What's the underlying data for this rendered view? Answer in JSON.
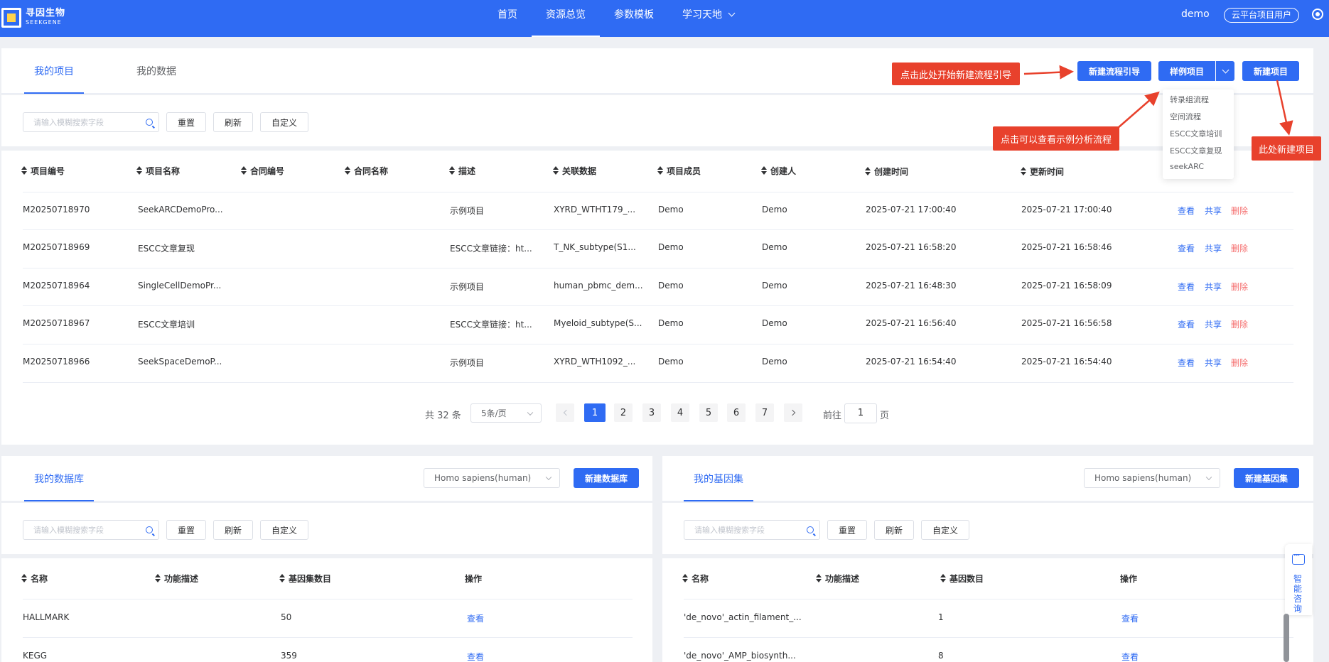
{
  "brand": {
    "name_cn": "寻因生物",
    "name_en": "SEEKGENE"
  },
  "nav": {
    "items": [
      {
        "label": "首页",
        "active": false
      },
      {
        "label": "资源总览",
        "active": true
      },
      {
        "label": "参数模板",
        "active": false
      },
      {
        "label": "学习天地",
        "active": false
      }
    ],
    "user": "demo",
    "role": "云平台项目用户"
  },
  "projects": {
    "tabs": [
      "我的项目",
      "我的数据"
    ],
    "buttons": {
      "new_flow": "新建流程引导",
      "sample": "样例项目",
      "new_project": "新建项目"
    },
    "sample_menu": [
      "转录组流程",
      "空间流程",
      "ESCC文章培训",
      "ESCC文章复现",
      "seekARC"
    ],
    "toolbar": {
      "search_placeholder": "请输入模糊搜索字段",
      "reset": "重置",
      "refresh": "刷新",
      "custom": "自定义"
    },
    "columns": [
      "项目编号",
      "项目名称",
      "合同编号",
      "合同名称",
      "描述",
      "关联数据",
      "项目成员",
      "创建人",
      "创建时间",
      "更新时间"
    ],
    "rows": [
      [
        "M20250718970",
        "SeekARCDemoPro...",
        "",
        "",
        "示例项目",
        "XYRD_WTHT179_...",
        "Demo",
        "Demo",
        "2025-07-21 17:00:40",
        "2025-07-21 17:00:40"
      ],
      [
        "M20250718969",
        "ESCC文章复现",
        "",
        "",
        "ESCC文章链接：ht...",
        "T_NK_subtype(S1...",
        "Demo",
        "Demo",
        "2025-07-21 16:58:20",
        "2025-07-21 16:58:46"
      ],
      [
        "M20250718964",
        "SingleCellDemoPr...",
        "",
        "",
        "示例项目",
        "human_pbmc_dem...",
        "Demo",
        "Demo",
        "2025-07-21 16:48:30",
        "2025-07-21 16:58:09"
      ],
      [
        "M20250718967",
        "ESCC文章培训",
        "",
        "",
        "ESCC文章链接：ht...",
        "Myeloid_subtype(S...",
        "Demo",
        "Demo",
        "2025-07-21 16:56:40",
        "2025-07-21 16:56:58"
      ],
      [
        "M20250718966",
        "SeekSpaceDemoP...",
        "",
        "",
        "示例项目",
        "XYRD_WTH1092_...",
        "Demo",
        "Demo",
        "2025-07-21 16:54:40",
        "2025-07-21 16:54:40"
      ]
    ],
    "actions": {
      "view": "查看",
      "share": "共享",
      "delete": "删除"
    },
    "pagination": {
      "total": "共 32 条",
      "page_size": "5条/页",
      "pages": [
        "1",
        "2",
        "3",
        "4",
        "5",
        "6",
        "7"
      ],
      "current": "1",
      "goto_prefix": "前往",
      "goto_value": "1",
      "goto_suffix": "页"
    }
  },
  "annotations": {
    "flow_hint": "点击此处开始新建流程引导",
    "sample_hint": "点击可以查看示例分析流程",
    "new_hint": "此处新建项目",
    "color": "#e8412c"
  },
  "database": {
    "tab": "我的数据库",
    "species": "Homo sapiens(human)",
    "new_button": "新建数据库",
    "toolbar": {
      "search_placeholder": "请输入模糊搜索字段",
      "reset": "重置",
      "refresh": "刷新",
      "custom": "自定义"
    },
    "columns": [
      "名称",
      "功能描述",
      "基因集数目",
      "操作"
    ],
    "rows": [
      {
        "name": "HALLMARK",
        "desc": "",
        "count": "50",
        "action": "查看"
      },
      {
        "name": "KEGG",
        "desc": "",
        "count": "359",
        "action": "查看"
      }
    ]
  },
  "geneset": {
    "tab": "我的基因集",
    "species": "Homo sapiens(human)",
    "new_button": "新建基因集",
    "toolbar": {
      "search_placeholder": "请输入模糊搜索字段",
      "reset": "重置",
      "refresh": "刷新",
      "custom": "自定义"
    },
    "columns": [
      "名称",
      "功能描述",
      "基因数目",
      "操作"
    ],
    "rows": [
      {
        "name": "'de_novo'_actin_filament_...",
        "desc": "",
        "count": "1",
        "action": "查看"
      },
      {
        "name": "'de_novo'_AMP_biosynth...",
        "desc": "",
        "count": "8",
        "action": "查看"
      }
    ]
  },
  "side_float": {
    "label": "智能咨询"
  },
  "colors": {
    "primary": "#2f6bf3",
    "danger": "#f56c6c",
    "background": "#eef0f4"
  }
}
